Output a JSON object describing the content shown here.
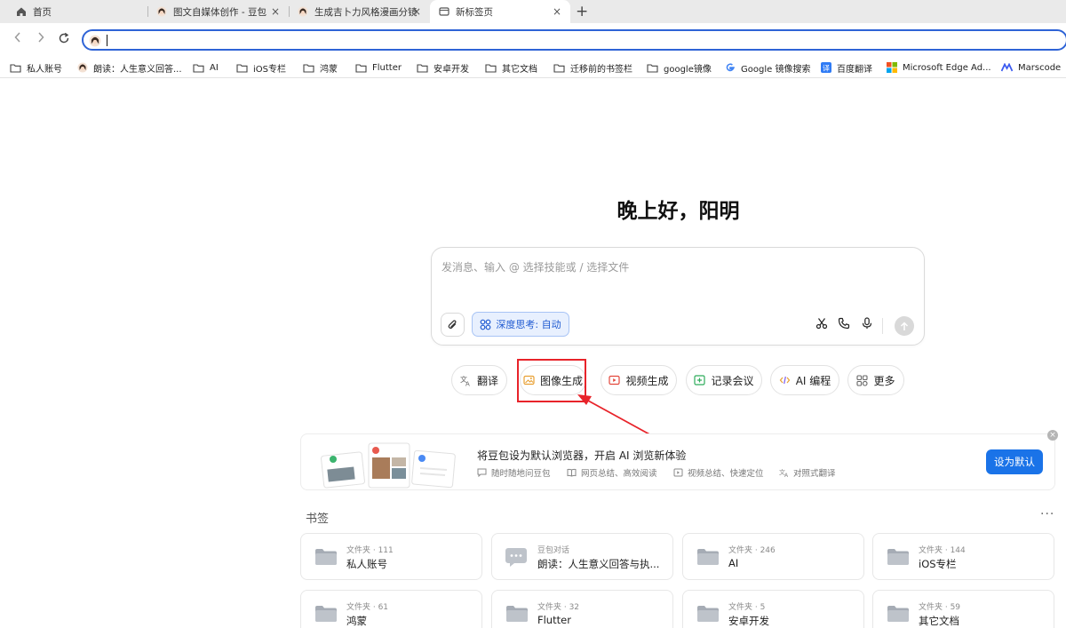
{
  "tabs": [
    {
      "title": "首页",
      "icon": "home-icon"
    },
    {
      "title": "图文自媒体创作 - 豆包",
      "icon": "doubao-avatar-icon"
    },
    {
      "title": "生成吉卜力风格漫画分镜",
      "icon": "doubao-avatar-icon"
    },
    {
      "title": "新标签页",
      "icon": "newtab-page-icon",
      "active": true
    }
  ],
  "toolbar": {
    "back": "‹",
    "forward": "›",
    "reload": "↻",
    "new_tab": "+",
    "close": "×"
  },
  "bookmarks_bar": [
    {
      "label": "私人账号",
      "icon": "folder-icon"
    },
    {
      "label": "朗读：人生意义回答...",
      "icon": "doubao-avatar-icon"
    },
    {
      "label": "AI",
      "icon": "folder-icon"
    },
    {
      "label": "iOS专栏",
      "icon": "folder-icon"
    },
    {
      "label": "鸿蒙",
      "icon": "folder-icon"
    },
    {
      "label": "Flutter",
      "icon": "folder-icon"
    },
    {
      "label": "安卓开发",
      "icon": "folder-icon"
    },
    {
      "label": "其它文档",
      "icon": "folder-icon"
    },
    {
      "label": "迁移前的书签栏",
      "icon": "folder-icon"
    },
    {
      "label": "google镜像",
      "icon": "folder-icon"
    },
    {
      "label": "Google 镜像搜索",
      "icon": "google-icon"
    },
    {
      "label": "百度翻译",
      "icon": "baidu-translate-icon"
    },
    {
      "label": "Microsoft Edge Ad...",
      "icon": "microsoft-icon"
    },
    {
      "label": "Marscode",
      "icon": "marscode-icon"
    }
  ],
  "greeting": "晚上好，阳明",
  "chat": {
    "placeholder": "发消息、输入 @ 选择技能或 / 选择文件",
    "deep_think_label": "深度思考: 自动"
  },
  "skills": [
    {
      "label": "翻译",
      "icon": "translate-icon"
    },
    {
      "label": "图像生成",
      "icon": "image-icon"
    },
    {
      "label": "视频生成",
      "icon": "video-icon"
    },
    {
      "label": "记录会议",
      "icon": "meeting-icon"
    },
    {
      "label": "AI 编程",
      "icon": "code-icon"
    },
    {
      "label": "更多",
      "icon": "more-apps-icon"
    }
  ],
  "banner": {
    "title": "将豆包设为默认浏览器，开启 AI 浏览新体验",
    "features": [
      "随时随地问豆包",
      "网页总结、高效阅读",
      "视频总结、快速定位",
      "对照式翻译"
    ],
    "button": "设为默认"
  },
  "bookmarks_section": {
    "title": "书签",
    "more": "···",
    "cards": [
      {
        "meta": "文件夹 · 111",
        "title": "私人账号",
        "icon": "folder-icon"
      },
      {
        "meta": "豆包对话",
        "title": "朗读：人生意义回答与执...",
        "icon": "chat-bubble-icon"
      },
      {
        "meta": "文件夹 · 246",
        "title": "AI",
        "icon": "folder-icon"
      },
      {
        "meta": "文件夹 · 144",
        "title": "iOS专栏",
        "icon": "folder-icon"
      },
      {
        "meta": "文件夹 · 61",
        "title": "鸿蒙",
        "icon": "folder-icon"
      },
      {
        "meta": "文件夹 · 32",
        "title": "Flutter",
        "icon": "folder-icon"
      },
      {
        "meta": "文件夹 · 5",
        "title": "安卓开发",
        "icon": "folder-icon"
      },
      {
        "meta": "文件夹 · 59",
        "title": "其它文档",
        "icon": "folder-icon"
      }
    ]
  },
  "colors": {
    "accent": "#1a73e8",
    "highlight_box": "#e8232a",
    "omnibox_border": "#2e63d6"
  }
}
